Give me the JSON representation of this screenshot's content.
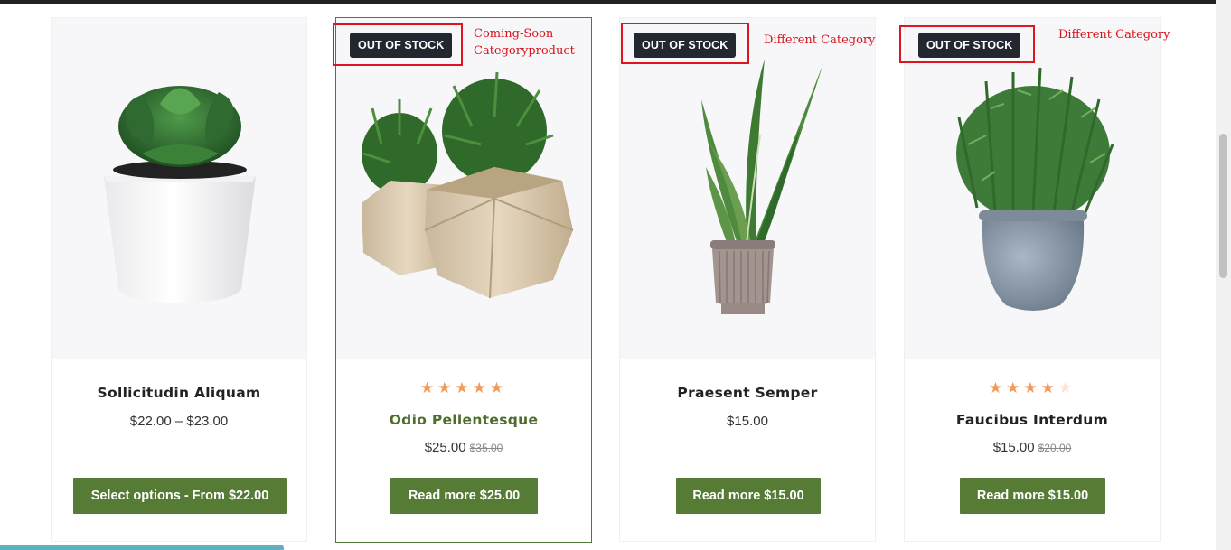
{
  "products": [
    {
      "name": "Sollicitudin Aliquam",
      "price": "$22.00 – $23.00",
      "button": "Select options - From $22.00"
    },
    {
      "badge": "OUT OF STOCK",
      "stars": "★★★★★",
      "name": "Odio Pellentesque",
      "price": "$25.00",
      "old_price": "$35.00",
      "button": "Read more $25.00"
    },
    {
      "badge": "OUT OF STOCK",
      "name": "Praesent Semper",
      "price": "$15.00",
      "button": "Read more $15.00"
    },
    {
      "badge": "OUT OF STOCK",
      "stars_filled": "★★★★",
      "stars_empty": "★",
      "rating": 4,
      "name": "Faucibus Interdum",
      "price": "$15.00",
      "old_price": "$20.00",
      "button": "Read more $15.00"
    }
  ],
  "annotations": [
    "Coming-Soon\nCategoryproduct",
    "Different Category",
    "Different Category"
  ],
  "colors": {
    "accent_button": "#557b35",
    "badge_bg": "#232830",
    "star": "#f49a59",
    "annotation": "#e0141e"
  }
}
